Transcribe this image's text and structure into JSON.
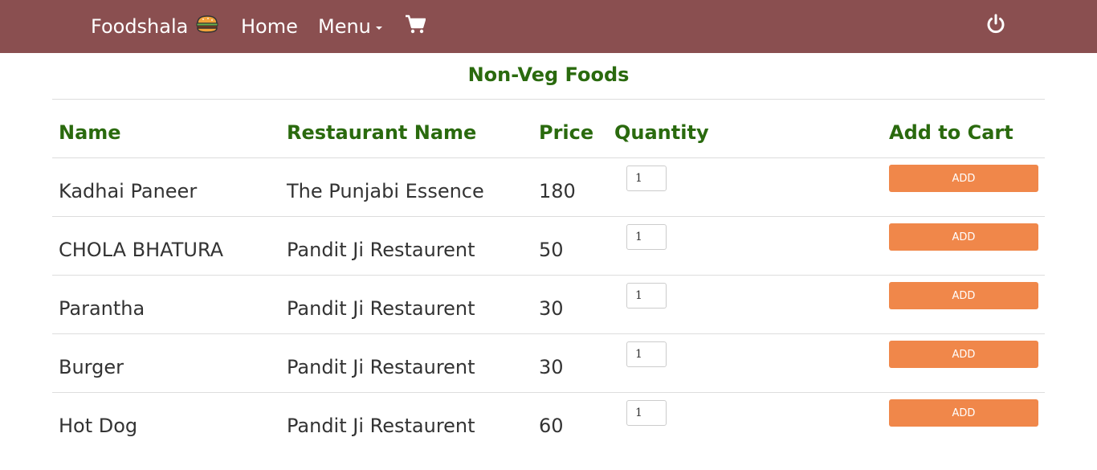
{
  "navbar": {
    "brand": "Foodshala",
    "brand_icon": "burger-icon",
    "home_label": "Home",
    "menu_label": "Menu",
    "cart_icon": "cart-icon",
    "power_icon": "power-icon",
    "background": "#8a4f50"
  },
  "page": {
    "title": "Non-Veg Foods"
  },
  "table": {
    "headers": {
      "name": "Name",
      "restaurant": "Restaurant Name",
      "price": "Price",
      "quantity": "Quantity",
      "add_to_cart": "Add to Cart"
    },
    "rows": [
      {
        "name": "Kadhai Paneer",
        "restaurant": "The Punjabi Essence",
        "price": "180",
        "quantity": "1",
        "button": "ADD"
      },
      {
        "name": "CHOLA BHATURA",
        "restaurant": "Pandit Ji Restaurent",
        "price": "50",
        "quantity": "1",
        "button": "ADD"
      },
      {
        "name": "Parantha",
        "restaurant": "Pandit Ji Restaurent",
        "price": "30",
        "quantity": "1",
        "button": "ADD"
      },
      {
        "name": "Burger",
        "restaurant": "Pandit Ji Restaurent",
        "price": "30",
        "quantity": "1",
        "button": "ADD"
      },
      {
        "name": "Hot Dog",
        "restaurant": "Pandit Ji Restaurent",
        "price": "60",
        "quantity": "1",
        "button": "ADD"
      }
    ]
  },
  "colors": {
    "heading_green": "#2a6a0e",
    "add_button": "#f0874a"
  }
}
